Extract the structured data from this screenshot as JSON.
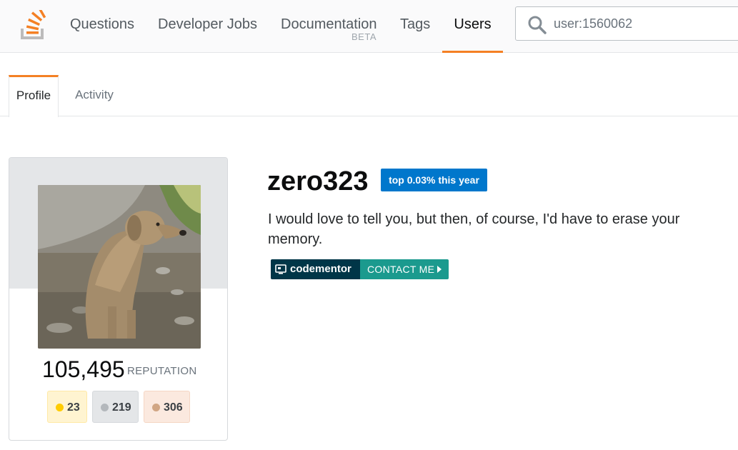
{
  "header": {
    "nav": {
      "questions": "Questions",
      "developer_jobs": "Developer Jobs",
      "documentation": "Documentation",
      "documentation_badge": "BETA",
      "tags": "Tags",
      "users": "Users"
    },
    "search": {
      "value": "user:1560062",
      "icon": "search-icon"
    },
    "accent_color": "#f48024"
  },
  "tabs": [
    {
      "label": "Profile",
      "active": true
    },
    {
      "label": "Activity",
      "active": false
    }
  ],
  "profile": {
    "username": "zero323",
    "rank_badge": "top 0.03% this year",
    "about": "I would love to tell you, but then, of course, I'd have to erase your memory.",
    "reputation": "105,495",
    "reputation_label": "REPUTATION",
    "badges": {
      "gold": "23",
      "silver": "219",
      "bronze": "306"
    },
    "codementor": {
      "name": "codementor",
      "cta": "CONTACT ME"
    }
  },
  "colors": {
    "rank_badge": "#0077cc",
    "codementor_dark": "#003648",
    "codementor_teal": "#1b9a8e",
    "gold": "#ffcc01",
    "silver": "#b4b8bc",
    "bronze": "#d1a684"
  }
}
